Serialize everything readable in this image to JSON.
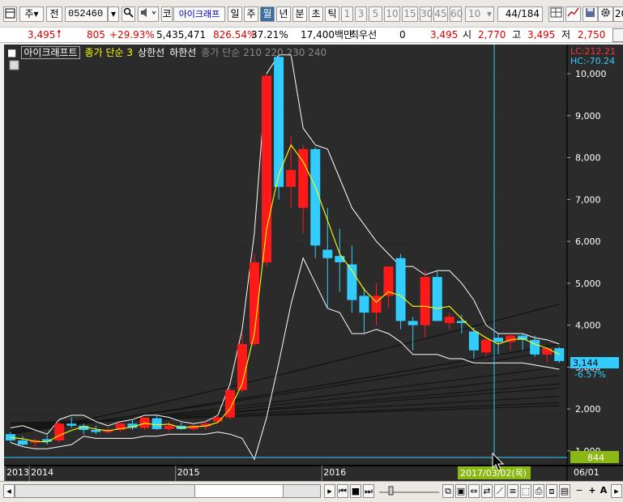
{
  "toolbar": {
    "market": "주",
    "jeon": "전",
    "code": "052460",
    "stock_prefix": "코",
    "stock_name": "아이크래프",
    "periods": [
      "일",
      "주",
      "월",
      "년",
      "분",
      "초",
      "틱"
    ],
    "selected_period": "월",
    "intervals": [
      "1",
      "3",
      "5",
      "10",
      "15",
      "30",
      "45",
      "60"
    ],
    "count_value": "10",
    "page_current": "44",
    "page_total": "/184",
    "far_right": "20"
  },
  "status": {
    "price": "3,495",
    "change": "805",
    "change_pct": "+29.93%",
    "volume": "5,435,471",
    "volume_pct": "826.54%",
    "turnover": "37.21%",
    "amount": "17,400백만",
    "priority_label": "최우선",
    "priority_value": "0",
    "price2": "3,495",
    "open_label": "시",
    "open": "2,770",
    "high_label": "고",
    "high": "3,495",
    "low_label": "저",
    "low": "2,750"
  },
  "legend": {
    "stock": "아이크래프트",
    "ma_label": "종가 단순 3",
    "upper": "상한선",
    "lower": "하한선",
    "extra": "종가 단순 210  220  230  240"
  },
  "right_axis": {
    "lc": "LC:212.21",
    "hc": "HC:-70.24",
    "ticks": [
      "10,000",
      "9,000",
      "8,000",
      "7,000",
      "6,000",
      "5,000",
      "4,000",
      "3,000",
      "2,000",
      "1,000"
    ],
    "current_price": "3,144",
    "current_pct": "-6.57%",
    "volume_marker": "844",
    "date_short": "06/01"
  },
  "x_axis": {
    "labels": [
      "2013",
      "2014",
      "2015",
      "2016"
    ],
    "crosshair_date": "2017/03/02(목)"
  },
  "colors": {
    "up": "#ff1a1a",
    "down": "#33ccff",
    "ma": "#ffff00",
    "band": "#ffffff",
    "background": "#2b2b2b"
  },
  "chart_data": {
    "type": "candlestick",
    "y_range": [
      650,
      10600
    ],
    "ma_label": "종가 단순 3",
    "candles": [
      {
        "o": 1400,
        "h": 1450,
        "l": 1200,
        "c": 1250
      },
      {
        "o": 1250,
        "h": 1350,
        "l": 1100,
        "c": 1150
      },
      {
        "o": 1200,
        "h": 1300,
        "l": 1100,
        "c": 1250
      },
      {
        "o": 1280,
        "h": 1380,
        "l": 1150,
        "c": 1220
      },
      {
        "o": 1250,
        "h": 1700,
        "l": 1200,
        "c": 1650
      },
      {
        "o": 1650,
        "h": 1800,
        "l": 1550,
        "c": 1600
      },
      {
        "o": 1600,
        "h": 1650,
        "l": 1400,
        "c": 1500
      },
      {
        "o": 1500,
        "h": 1600,
        "l": 1400,
        "c": 1450
      },
      {
        "o": 1450,
        "h": 1550,
        "l": 1400,
        "c": 1500
      },
      {
        "o": 1500,
        "h": 1700,
        "l": 1450,
        "c": 1650
      },
      {
        "o": 1650,
        "h": 1750,
        "l": 1500,
        "c": 1550
      },
      {
        "o": 1550,
        "h": 1800,
        "l": 1500,
        "c": 1800
      },
      {
        "o": 1780,
        "h": 1850,
        "l": 1500,
        "c": 1520
      },
      {
        "o": 1520,
        "h": 1700,
        "l": 1450,
        "c": 1600
      },
      {
        "o": 1600,
        "h": 1680,
        "l": 1500,
        "c": 1520
      },
      {
        "o": 1520,
        "h": 1620,
        "l": 1480,
        "c": 1600
      },
      {
        "o": 1580,
        "h": 1700,
        "l": 1500,
        "c": 1650
      },
      {
        "o": 1700,
        "h": 1850,
        "l": 1650,
        "c": 1800
      },
      {
        "o": 1800,
        "h": 2500,
        "l": 1750,
        "c": 2450
      },
      {
        "o": 2450,
        "h": 3800,
        "l": 2400,
        "c": 3550
      },
      {
        "o": 3550,
        "h": 5700,
        "l": 3500,
        "c": 5500
      },
      {
        "o": 5500,
        "h": 10000,
        "l": 5400,
        "c": 9950
      },
      {
        "o": 10400,
        "h": 10450,
        "l": 7000,
        "c": 7300
      },
      {
        "o": 7300,
        "h": 8500,
        "l": 6800,
        "c": 7700
      },
      {
        "o": 6800,
        "h": 8300,
        "l": 6200,
        "c": 8200
      },
      {
        "o": 8200,
        "h": 8250,
        "l": 5600,
        "c": 5900
      },
      {
        "o": 5800,
        "h": 6800,
        "l": 4400,
        "c": 5600
      },
      {
        "o": 5650,
        "h": 6300,
        "l": 4800,
        "c": 5500
      },
      {
        "o": 5450,
        "h": 5900,
        "l": 4300,
        "c": 4600
      },
      {
        "o": 4700,
        "h": 4900,
        "l": 3800,
        "c": 4300
      },
      {
        "o": 4300,
        "h": 5000,
        "l": 4000,
        "c": 4700
      },
      {
        "o": 4700,
        "h": 5300,
        "l": 4400,
        "c": 5400
      },
      {
        "o": 5600,
        "h": 5700,
        "l": 3900,
        "c": 4100
      },
      {
        "o": 4100,
        "h": 4200,
        "l": 3400,
        "c": 4000
      },
      {
        "o": 4000,
        "h": 5300,
        "l": 3700,
        "c": 5150
      },
      {
        "o": 5150,
        "h": 5300,
        "l": 4100,
        "c": 4100
      },
      {
        "o": 4050,
        "h": 4300,
        "l": 3900,
        "c": 4200
      },
      {
        "o": 4100,
        "h": 4250,
        "l": 3800,
        "c": 4050
      },
      {
        "o": 3850,
        "h": 3950,
        "l": 3200,
        "c": 3400
      },
      {
        "o": 3350,
        "h": 3700,
        "l": 3250,
        "c": 3650
      },
      {
        "o": 3700,
        "h": 3800,
        "l": 3300,
        "c": 3600
      },
      {
        "o": 3600,
        "h": 3800,
        "l": 3400,
        "c": 3750
      },
      {
        "o": 3750,
        "h": 3800,
        "l": 3400,
        "c": 3650
      },
      {
        "o": 3650,
        "h": 3750,
        "l": 3250,
        "c": 3300
      },
      {
        "o": 3300,
        "h": 3450,
        "l": 3100,
        "c": 3450
      },
      {
        "o": 3450,
        "h": 3480,
        "l": 3100,
        "c": 3144
      }
    ],
    "ma": [
      1320,
      1290,
      1230,
      1210,
      1370,
      1490,
      1580,
      1520,
      1480,
      1530,
      1570,
      1660,
      1620,
      1640,
      1550,
      1580,
      1590,
      1680,
      2000,
      2600,
      3800,
      6300,
      7600,
      8300,
      7900,
      7300,
      6500,
      5700,
      5300,
      4850,
      4550,
      4800,
      4700,
      4450,
      4450,
      4400,
      4450,
      4150,
      3880,
      3700,
      3550,
      3650,
      3680,
      3550,
      3450,
      3300
    ],
    "upper": [
      1550,
      1600,
      1500,
      1400,
      1750,
      1850,
      1850,
      1700,
      1600,
      1700,
      1750,
      1850,
      1850,
      1800,
      1700,
      1650,
      1700,
      1850,
      2600,
      3900,
      6200,
      10000,
      10450,
      10450,
      8700,
      8300,
      8200,
      7500,
      6800,
      6400,
      6000,
      5700,
      5400,
      5400,
      5200,
      5300,
      5300,
      5000,
      4600,
      4000,
      3800,
      3800,
      3800,
      3700,
      3650,
      3550
    ],
    "lower": [
      1200,
      1100,
      1050,
      1050,
      1100,
      1150,
      1350,
      1300,
      1300,
      1300,
      1300,
      1350,
      1350,
      1400,
      1400,
      1400,
      1400,
      1450,
      1400,
      1300,
      800,
      1800,
      3100,
      4500,
      5600,
      5000,
      4400,
      4300,
      3800,
      3800,
      3900,
      3800,
      3600,
      3300,
      3300,
      3300,
      3200,
      3200,
      3100,
      3100,
      3100,
      3100,
      3100,
      3050,
      3000,
      2950
    ],
    "long_ma_end_values": [
      4500,
      3550,
      3400,
      3000,
      2800,
      2600,
      2500,
      2300,
      2150,
      2080
    ]
  }
}
